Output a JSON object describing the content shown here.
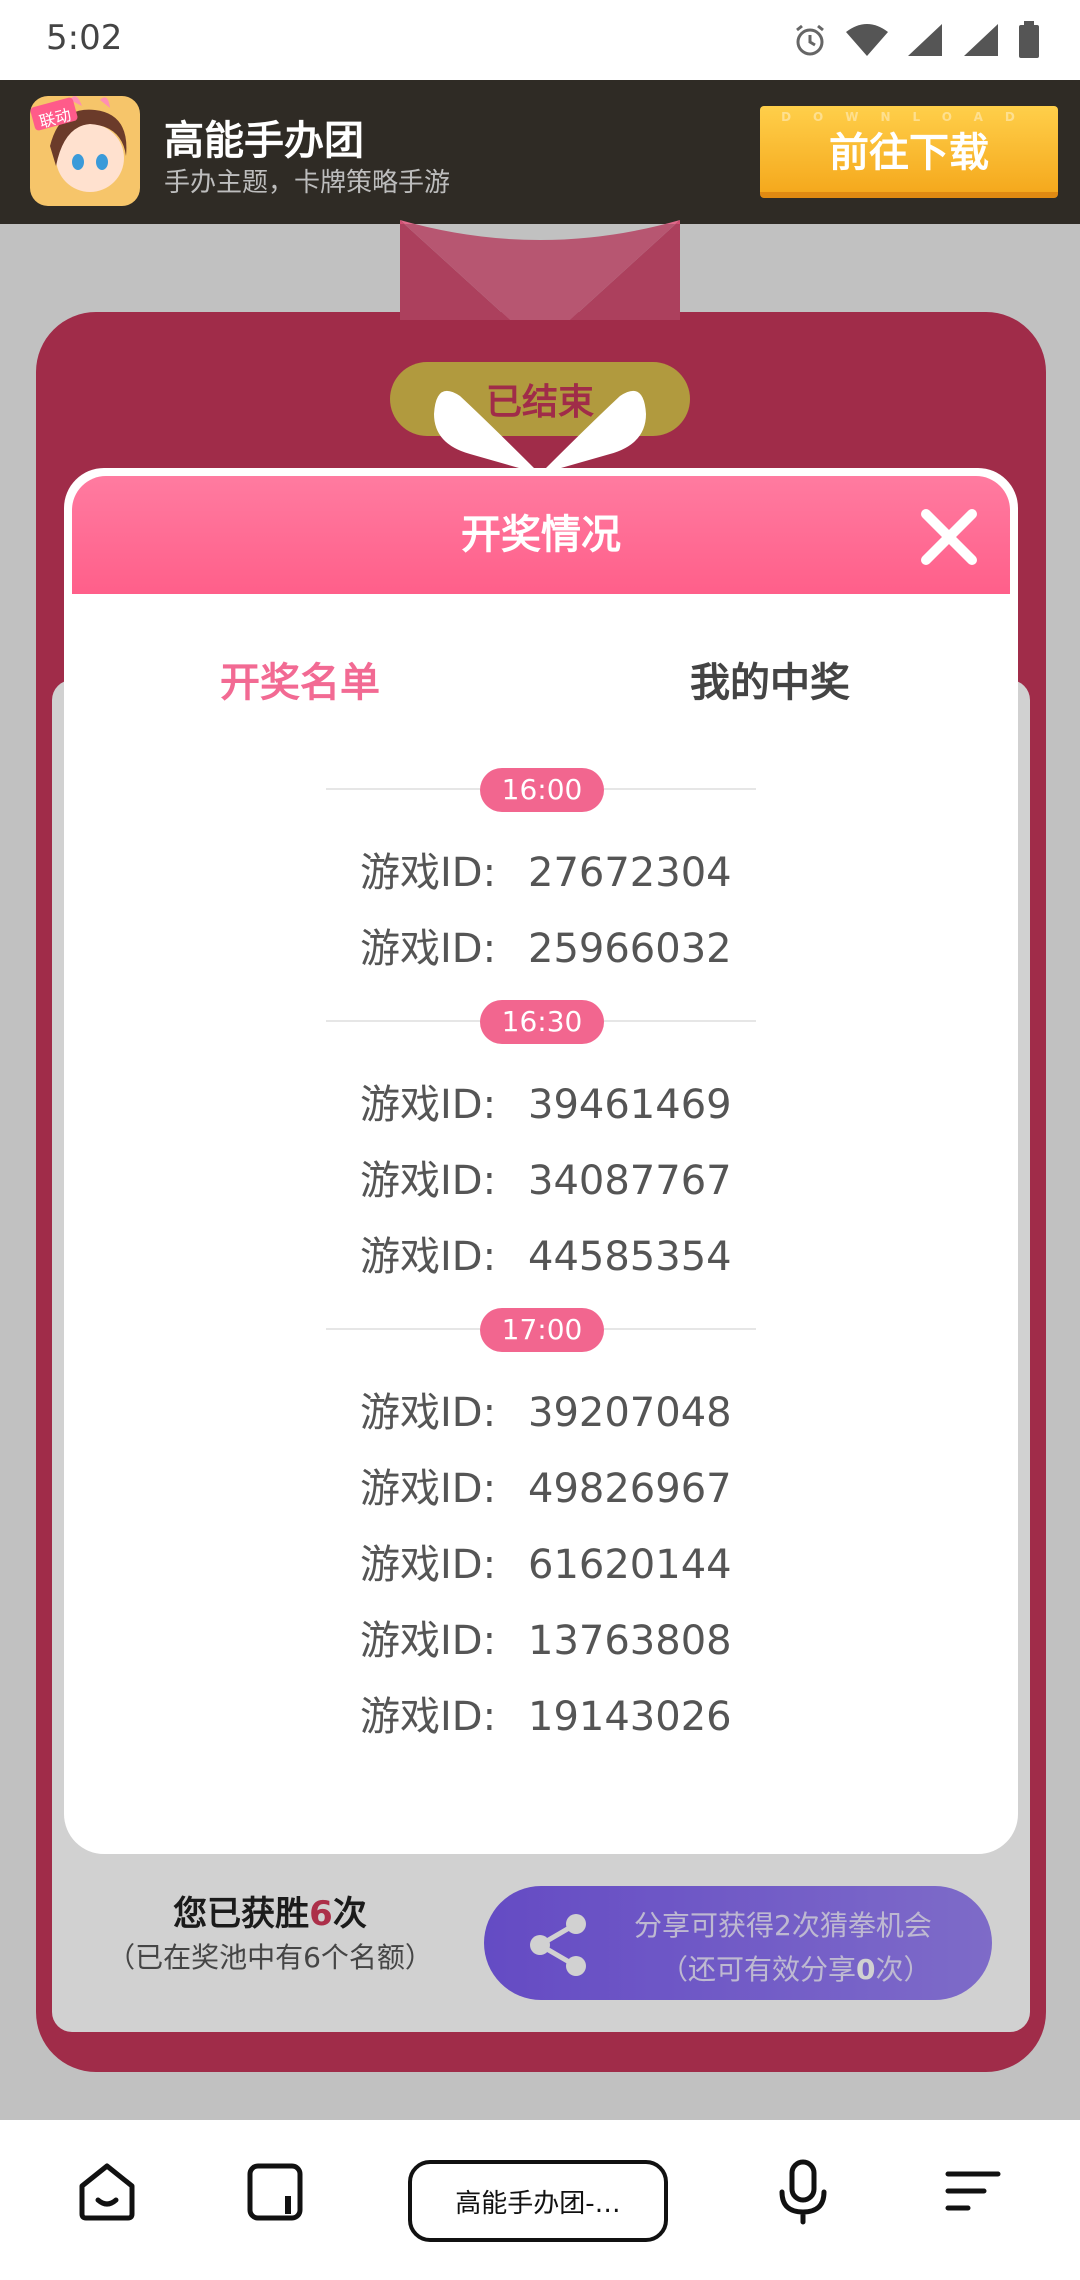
{
  "status_bar": {
    "time": "5:02"
  },
  "ad": {
    "title": "高能手办团",
    "subtitle": "手办主题，卡牌策略手游",
    "logo_badge": "联动",
    "download_label": "前往下载",
    "download_word": "DOWNLOAD"
  },
  "background": {
    "status_pill": "已结束",
    "wins_prefix": "您已获胜",
    "wins_count": "6",
    "wins_suffix": "次",
    "pool_text": "（已在奖池中有6个名额）",
    "share_line1": "分享可获得2次猜拳机会",
    "share_line2_prefix": "（还可有效分享",
    "share_line2_count": "0",
    "share_line2_suffix": "次）"
  },
  "modal": {
    "title": "开奖情况",
    "tabs": {
      "list": "开奖名单",
      "mine": "我的中奖"
    },
    "id_label": "游戏ID:",
    "groups": [
      {
        "time": "16:00",
        "ids": [
          "27672304",
          "25966032"
        ]
      },
      {
        "time": "16:30",
        "ids": [
          "39461469",
          "34087767",
          "44585354"
        ]
      },
      {
        "time": "17:00",
        "ids": [
          "39207048",
          "49826967",
          "61620144",
          "13763808",
          "19143026"
        ]
      }
    ]
  },
  "bottom_nav": {
    "url_label": "高能手办团-…"
  },
  "colors": {
    "accent_pink": "#f2668f",
    "card_red": "#c4365a",
    "share_purple": "#7b5cf0",
    "download_yellow": "#f5a91d"
  },
  "icons": [
    "alarm-icon",
    "wifi-icon",
    "signal-icon",
    "battery-icon",
    "close-icon",
    "share-icon",
    "home-icon",
    "tabs-icon",
    "mic-icon",
    "menu-icon"
  ]
}
